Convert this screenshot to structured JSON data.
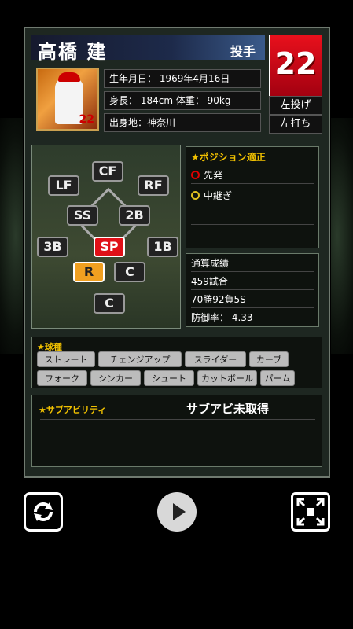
{
  "player": {
    "name": "高橋 建",
    "position": "投手",
    "number": "22",
    "throws": "左投げ",
    "bats": "左打ち",
    "birth": "生年月日：  1969年4月16日",
    "body": "身長：  184cm  体重：  90kg",
    "birthplace": "出身地：神奈川"
  },
  "field_positions": [
    "CF",
    "LF",
    "RF",
    "SS",
    "2B",
    "3B",
    "SP",
    "1B",
    "R",
    "C",
    "C"
  ],
  "position_aptitude": {
    "title": "★ポジション適正",
    "items": [
      "先発",
      "中継ぎ"
    ]
  },
  "career_stats": {
    "title": "通算成績",
    "games": "459試合",
    "record": "70勝92負5S",
    "era": "防御率：  4.33"
  },
  "pitches": {
    "title": "★球種",
    "row1": [
      "ストレート",
      "チェンジアップ",
      "スライダー",
      "カーブ"
    ],
    "row2": [
      "フォーク",
      "シンカー",
      "シュート",
      "カットボール",
      "パーム"
    ]
  },
  "sub_ability": {
    "title": "★サブアビリティ",
    "value": "サブアビ未取得"
  },
  "colors": {
    "number_bg": "#e01018",
    "accent_gold": "#f0c000",
    "sp_badge": "#e01018",
    "r_badge": "#f0a020"
  },
  "controls": [
    "rotate-icon",
    "play-icon",
    "fullscreen-icon"
  ]
}
